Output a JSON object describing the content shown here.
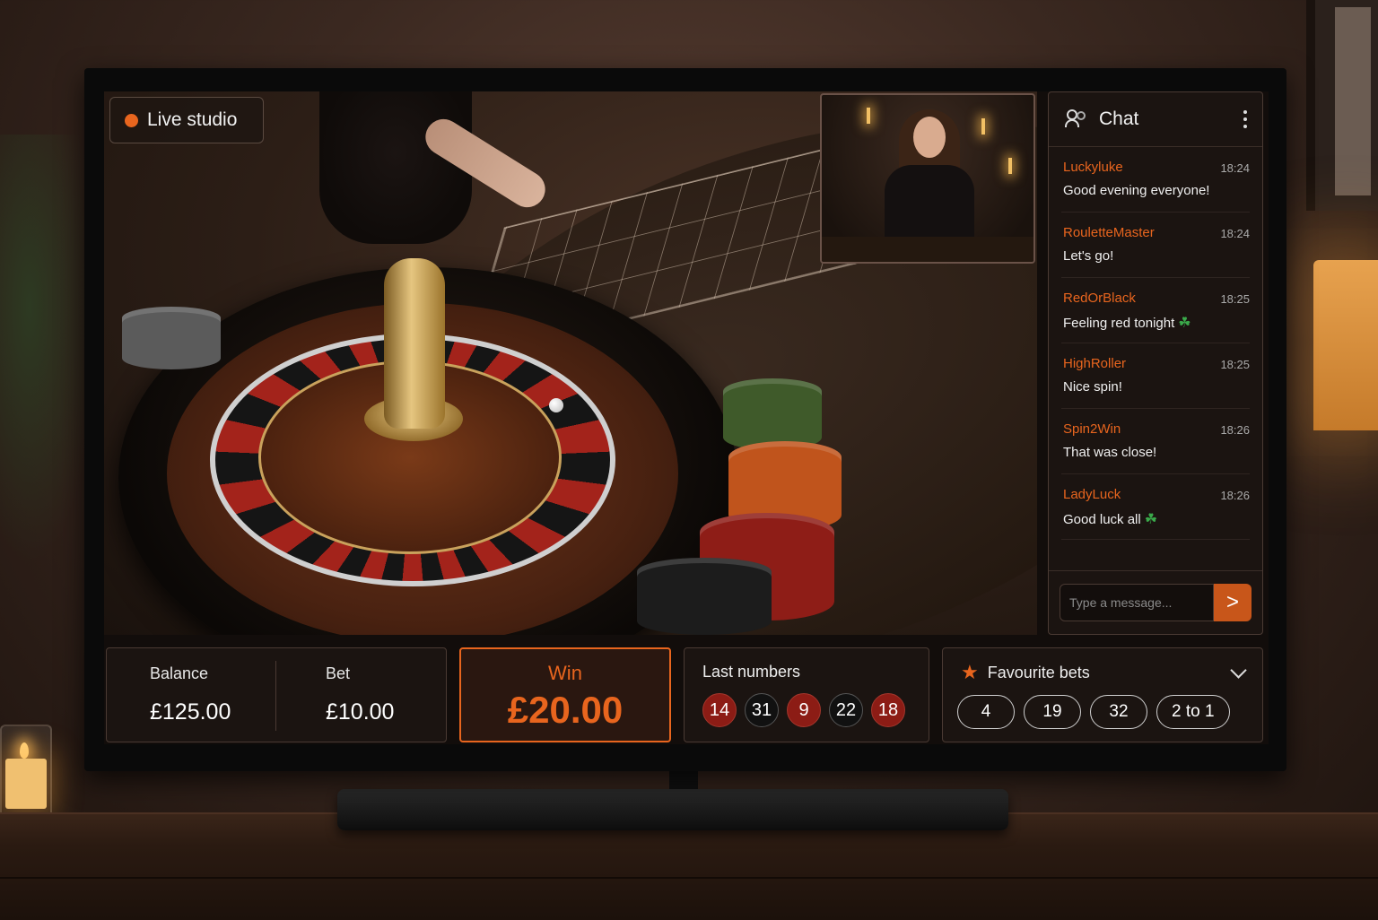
{
  "live": {
    "label": "Live studio"
  },
  "chat": {
    "title": "Chat",
    "messages": [
      {
        "user": "Luckyluke",
        "time": "18:24",
        "text": "Good evening everyone!"
      },
      {
        "user": "RouletteMaster",
        "time": "18:24",
        "text": "Let's go!"
      },
      {
        "user": "RedOrBlack",
        "time": "18:25",
        "text": "Feeling red tonight",
        "emoji": "☘"
      },
      {
        "user": "HighRoller",
        "time": "18:25",
        "text": "Nice spin!"
      },
      {
        "user": "Spin2Win",
        "time": "18:26",
        "text": "That was close!"
      },
      {
        "user": "LadyLuck",
        "time": "18:26",
        "text": "Good luck all",
        "emoji": "☘"
      }
    ],
    "input_placeholder": "Type a message...",
    "send_label": ">"
  },
  "balance": {
    "label": "Balance",
    "value": "£125.00"
  },
  "bet": {
    "label": "Bet",
    "value": "£10.00"
  },
  "win": {
    "label": "Win",
    "value": "£20.00"
  },
  "last_numbers": {
    "title": "Last numbers",
    "items": [
      {
        "n": "14",
        "color": "red"
      },
      {
        "n": "31",
        "color": "black"
      },
      {
        "n": "9",
        "color": "red"
      },
      {
        "n": "22",
        "color": "black"
      },
      {
        "n": "18",
        "color": "red"
      }
    ]
  },
  "favourite_bets": {
    "title": "Favourite bets",
    "items": [
      "4",
      "19",
      "32",
      "2 to 1"
    ]
  },
  "colors": {
    "accent": "#e8651e",
    "red": "#8c1c15",
    "black": "#111111"
  },
  "icons": {
    "live": "live-dot-icon",
    "chat": "users-icon",
    "menu": "kebab-menu-icon",
    "fav": "star-icon",
    "expand": "chevron-down-icon",
    "send": "send-icon"
  }
}
